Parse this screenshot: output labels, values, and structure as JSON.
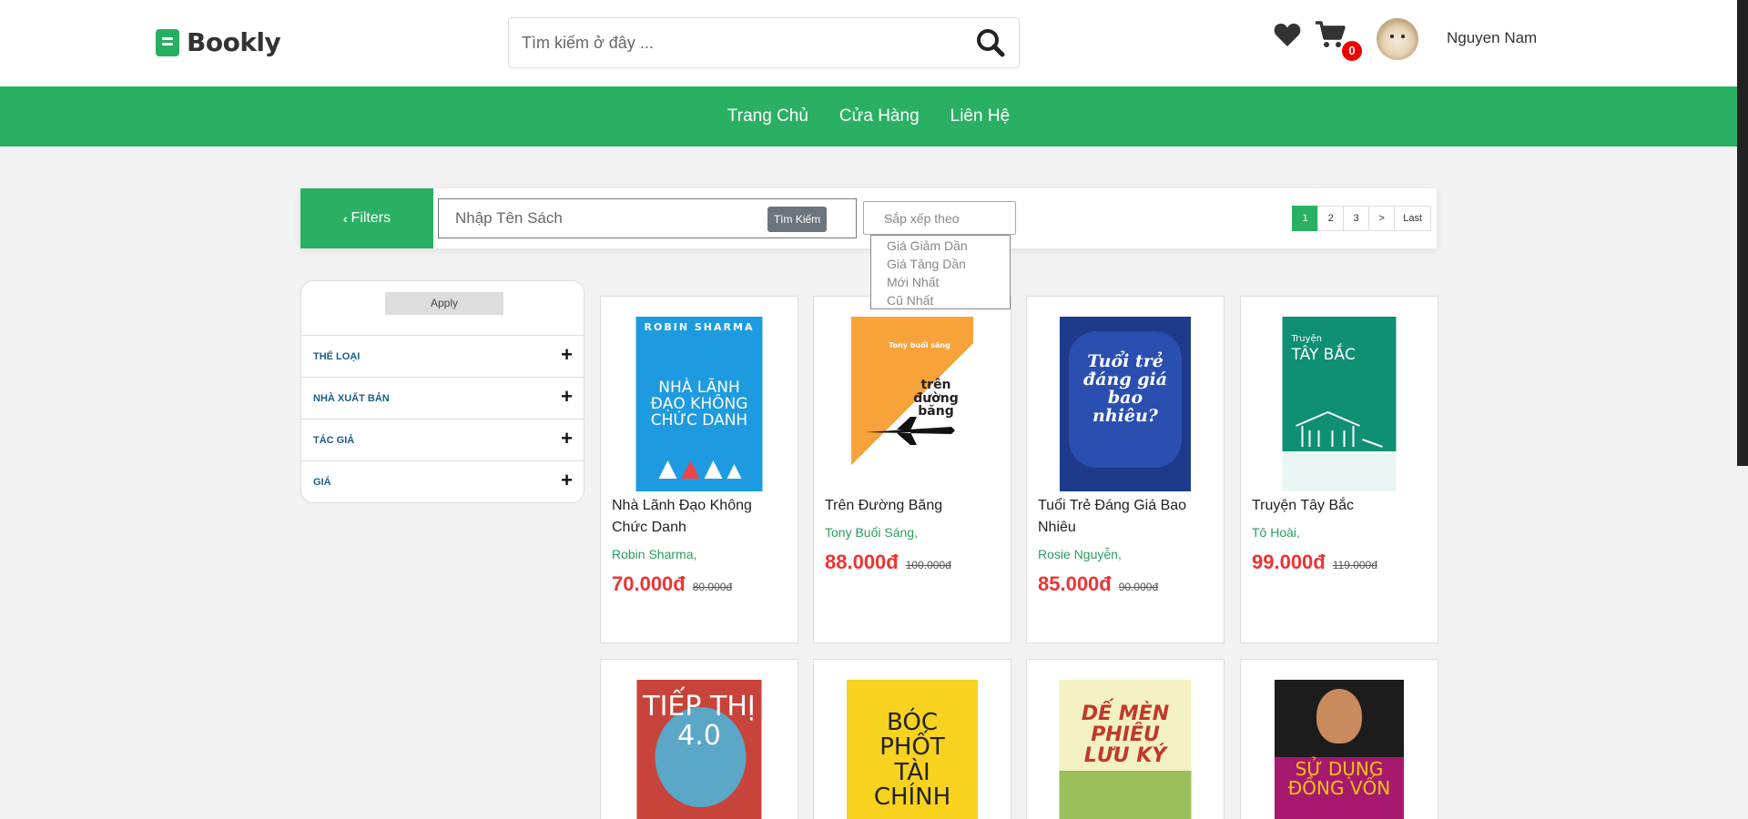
{
  "header": {
    "brand": "Bookly",
    "search_placeholder": "Tìm kiếm ở đây ...",
    "cart_count": "0",
    "username": "Nguyen Nam"
  },
  "nav": {
    "items": [
      "Trang Chủ",
      "Cửa Hàng",
      "Liên Hệ"
    ]
  },
  "toolbar": {
    "filters_label": "Filters",
    "name_placeholder": "Nhập Tên Sách",
    "search_button": "Tìm Kiếm",
    "sort_placeholder": "Sắp xếp theo",
    "sort_options": [
      "Giá Giảm Dần",
      "Giá Tăng Dần",
      "Mới Nhất",
      "Cũ Nhất"
    ],
    "pages": [
      "1",
      "2",
      "3",
      ">",
      "Last"
    ]
  },
  "sidebar": {
    "apply_label": "Apply",
    "groups": [
      "THỂ LOẠI",
      "NHÀ XUẤT BẢN",
      "TÁC GIẢ",
      "GIÁ"
    ]
  },
  "products": [
    {
      "title": "Nhà Lãnh Đạo Không Chức Danh",
      "author": "Robin Sharma,",
      "price": "70.000đ",
      "old_price": "80.000đ",
      "cover_text": "NHÀ LÃNH ĐẠO KHÔNG CHỨC DANH",
      "cover_top": "ROBIN SHARMA",
      "cover_color": "#1e9be0"
    },
    {
      "title": "Trên Đường Băng",
      "author": "Tony Buổi Sáng,",
      "price": "88.000đ",
      "old_price": "100.000đ",
      "cover_text": "trên đường băng",
      "cover_top": "Tony buổi sáng",
      "cover_color": "#f7a33a"
    },
    {
      "title": "Tuổi Trẻ Đáng Giá Bao Nhiêu",
      "author": "Rosie Nguyễn,",
      "price": "85.000đ",
      "old_price": "90.000đ",
      "cover_text": "Tuổi trẻ đáng giá bao nhiêu?",
      "cover_top": "",
      "cover_color": "#1d3b8a"
    },
    {
      "title": "Truyện Tây Bắc",
      "author": "Tô Hoài,",
      "price": "99.000đ",
      "old_price": "119.000đ",
      "cover_text": "TÂY BẮC",
      "cover_top": "Truyện",
      "cover_color": "#0f8f74"
    }
  ],
  "products_row2": [
    {
      "cover_text": "TIẾP THỊ 4.0",
      "cover_color": "#c8433a"
    },
    {
      "cover_text": "BÓC PHỐT TÀI CHÍNH",
      "cover_color": "#f7d21e"
    },
    {
      "cover_text": "DẾ MÈN PHIÊU LƯU KÝ",
      "cover_color": "#f3f0c2"
    },
    {
      "cover_text": "SỬ DỤNG ĐỒNG VỐN",
      "cover_color": "#1c1c1c"
    }
  ]
}
